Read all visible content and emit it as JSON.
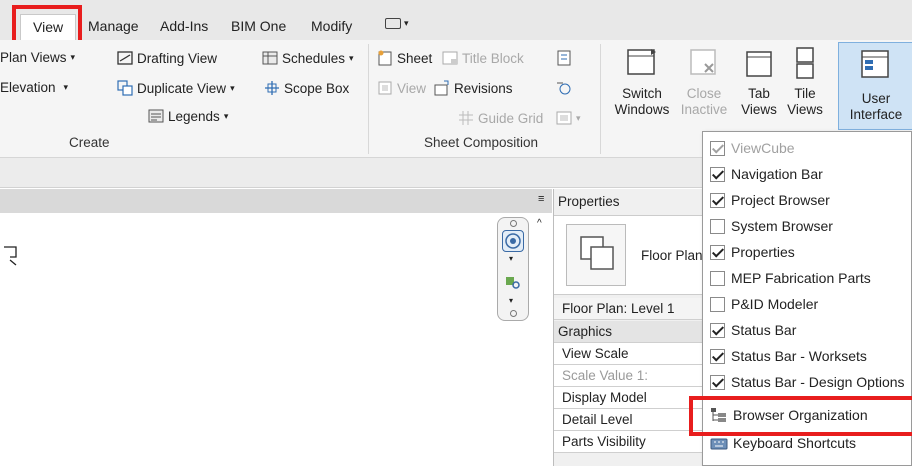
{
  "tabs": [
    {
      "label": "View",
      "active": true
    },
    {
      "label": "Manage"
    },
    {
      "label": "Add-Ins"
    },
    {
      "label": "BIM One"
    },
    {
      "label": "Modify"
    }
  ],
  "ribbon": {
    "create": {
      "plan_views": "Plan Views",
      "elevation": "Elevation",
      "drafting_view": "Drafting View",
      "duplicate_view": "Duplicate View",
      "legends": "Legends",
      "schedules": "Schedules",
      "scope_box": "Scope Box",
      "panel_title": "Create"
    },
    "sheet_composition": {
      "sheet": "Sheet",
      "title_block": "Title Block",
      "view": "View",
      "revisions": "Revisions",
      "guide_grid": "Guide Grid",
      "panel_title": "Sheet Composition"
    },
    "windows": {
      "switch_line1": "Switch",
      "switch_line2": "Windows",
      "close_line1": "Close",
      "close_line2": "Inactive",
      "tab_line1": "Tab",
      "tab_line2": "Views",
      "tile_line1": "Tile",
      "tile_line2": "Views",
      "ui_line1": "User",
      "ui_line2": "Interface"
    }
  },
  "properties": {
    "title": "Properties",
    "type_name": "Floor Plan",
    "instance_selector": "Floor Plan: Level 1",
    "group": "Graphics",
    "rows": [
      {
        "label": "View Scale",
        "disabled": false
      },
      {
        "label": "Scale Value    1:",
        "disabled": true
      },
      {
        "label": "Display Model",
        "disabled": false
      },
      {
        "label": "Detail Level",
        "disabled": false
      },
      {
        "label": "Parts Visibility",
        "disabled": false
      }
    ]
  },
  "menu": {
    "items": [
      {
        "label": "ViewCube",
        "checked": true,
        "disabled": true
      },
      {
        "label": "Navigation Bar",
        "checked": true
      },
      {
        "label": "Project Browser",
        "checked": true
      },
      {
        "label": "System Browser",
        "checked": false
      },
      {
        "label": "Properties",
        "checked": true
      },
      {
        "label": "MEP Fabrication Parts",
        "checked": false
      },
      {
        "label": "P&ID Modeler",
        "checked": false
      },
      {
        "label": "Status Bar",
        "checked": true
      },
      {
        "label": "Status Bar - Worksets",
        "checked": true
      },
      {
        "label": "Status Bar - Design Options",
        "checked": true
      }
    ],
    "browser_organization": "Browser Organization",
    "keyboard_shortcuts": "Keyboard Shortcuts"
  },
  "colors": {
    "highlight": "#e81d1d",
    "ui_button_bg": "#cfe3f5"
  }
}
